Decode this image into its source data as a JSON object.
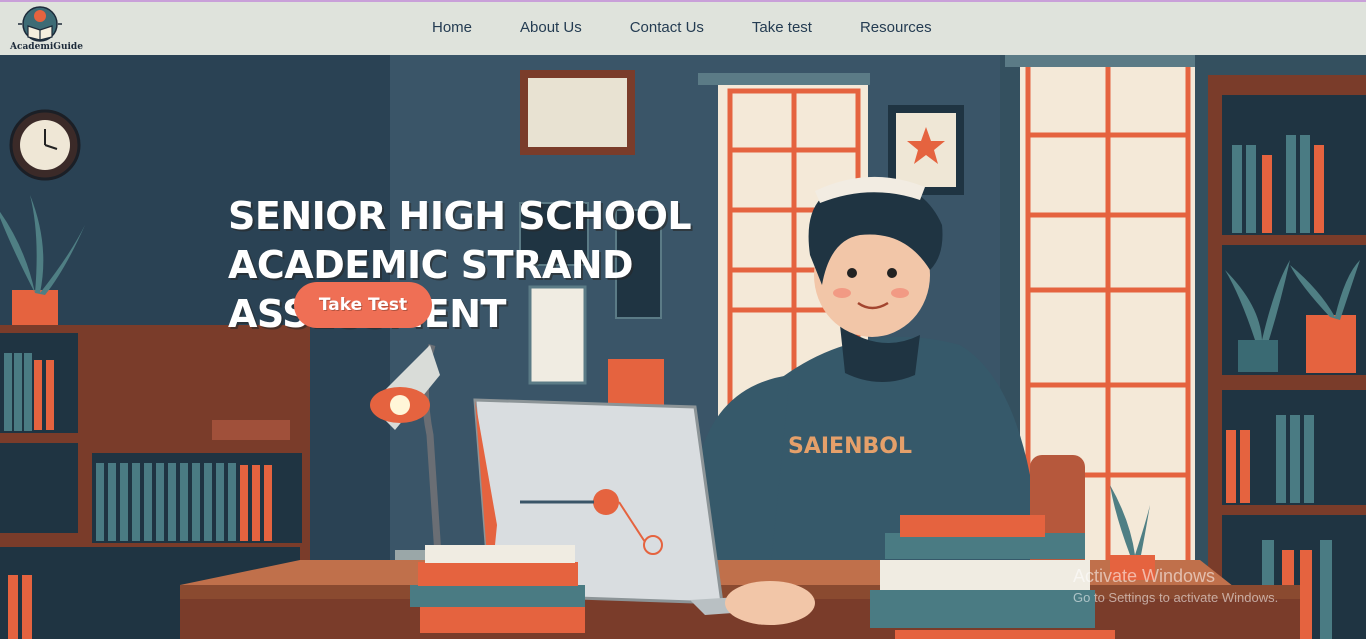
{
  "header": {
    "logo_text": "AcademiGuide",
    "nav": [
      "Home",
      "About Us",
      "Contact Us",
      "Take test",
      "Resources"
    ]
  },
  "hero": {
    "title_lines": [
      "SENIOR HIGH SCHOOL",
      "ACADEMIC STRAND",
      "ASSESSMENT"
    ],
    "cta_label": "Take Test",
    "sweatshirt_text": "SAIENBOL"
  },
  "watermark": {
    "line1": "Activate Windows",
    "line2": "Go to Settings to activate Windows."
  },
  "colors": {
    "nav_bg": "#dfe3dc",
    "nav_text": "#243c52",
    "cta_bg": "#ef6f55",
    "wall": "#2f4a5c",
    "accent": "#e5633f"
  },
  "icons": {
    "logo": "book-globe-icon"
  }
}
